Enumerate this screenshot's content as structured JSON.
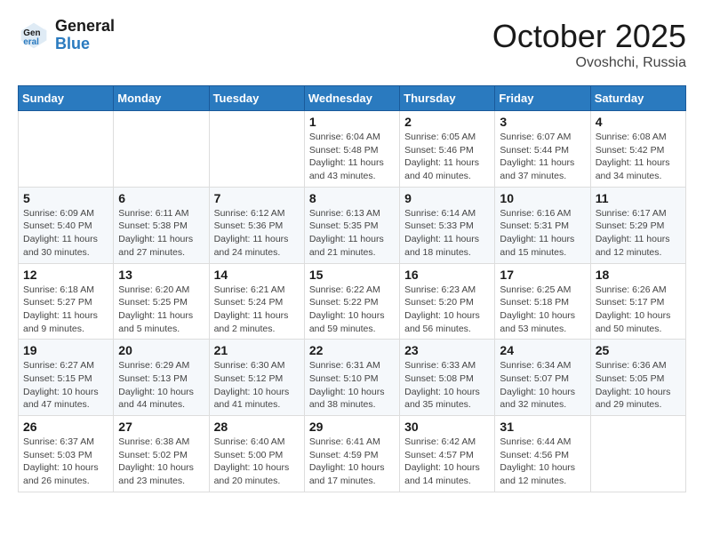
{
  "header": {
    "logo_general": "General",
    "logo_blue": "Blue",
    "month": "October 2025",
    "location": "Ovoshchi, Russia"
  },
  "weekdays": [
    "Sunday",
    "Monday",
    "Tuesday",
    "Wednesday",
    "Thursday",
    "Friday",
    "Saturday"
  ],
  "weeks": [
    [
      {
        "day": "",
        "info": ""
      },
      {
        "day": "",
        "info": ""
      },
      {
        "day": "",
        "info": ""
      },
      {
        "day": "1",
        "info": "Sunrise: 6:04 AM\nSunset: 5:48 PM\nDaylight: 11 hours\nand 43 minutes."
      },
      {
        "day": "2",
        "info": "Sunrise: 6:05 AM\nSunset: 5:46 PM\nDaylight: 11 hours\nand 40 minutes."
      },
      {
        "day": "3",
        "info": "Sunrise: 6:07 AM\nSunset: 5:44 PM\nDaylight: 11 hours\nand 37 minutes."
      },
      {
        "day": "4",
        "info": "Sunrise: 6:08 AM\nSunset: 5:42 PM\nDaylight: 11 hours\nand 34 minutes."
      }
    ],
    [
      {
        "day": "5",
        "info": "Sunrise: 6:09 AM\nSunset: 5:40 PM\nDaylight: 11 hours\nand 30 minutes."
      },
      {
        "day": "6",
        "info": "Sunrise: 6:11 AM\nSunset: 5:38 PM\nDaylight: 11 hours\nand 27 minutes."
      },
      {
        "day": "7",
        "info": "Sunrise: 6:12 AM\nSunset: 5:36 PM\nDaylight: 11 hours\nand 24 minutes."
      },
      {
        "day": "8",
        "info": "Sunrise: 6:13 AM\nSunset: 5:35 PM\nDaylight: 11 hours\nand 21 minutes."
      },
      {
        "day": "9",
        "info": "Sunrise: 6:14 AM\nSunset: 5:33 PM\nDaylight: 11 hours\nand 18 minutes."
      },
      {
        "day": "10",
        "info": "Sunrise: 6:16 AM\nSunset: 5:31 PM\nDaylight: 11 hours\nand 15 minutes."
      },
      {
        "day": "11",
        "info": "Sunrise: 6:17 AM\nSunset: 5:29 PM\nDaylight: 11 hours\nand 12 minutes."
      }
    ],
    [
      {
        "day": "12",
        "info": "Sunrise: 6:18 AM\nSunset: 5:27 PM\nDaylight: 11 hours\nand 9 minutes."
      },
      {
        "day": "13",
        "info": "Sunrise: 6:20 AM\nSunset: 5:25 PM\nDaylight: 11 hours\nand 5 minutes."
      },
      {
        "day": "14",
        "info": "Sunrise: 6:21 AM\nSunset: 5:24 PM\nDaylight: 11 hours\nand 2 minutes."
      },
      {
        "day": "15",
        "info": "Sunrise: 6:22 AM\nSunset: 5:22 PM\nDaylight: 10 hours\nand 59 minutes."
      },
      {
        "day": "16",
        "info": "Sunrise: 6:23 AM\nSunset: 5:20 PM\nDaylight: 10 hours\nand 56 minutes."
      },
      {
        "day": "17",
        "info": "Sunrise: 6:25 AM\nSunset: 5:18 PM\nDaylight: 10 hours\nand 53 minutes."
      },
      {
        "day": "18",
        "info": "Sunrise: 6:26 AM\nSunset: 5:17 PM\nDaylight: 10 hours\nand 50 minutes."
      }
    ],
    [
      {
        "day": "19",
        "info": "Sunrise: 6:27 AM\nSunset: 5:15 PM\nDaylight: 10 hours\nand 47 minutes."
      },
      {
        "day": "20",
        "info": "Sunrise: 6:29 AM\nSunset: 5:13 PM\nDaylight: 10 hours\nand 44 minutes."
      },
      {
        "day": "21",
        "info": "Sunrise: 6:30 AM\nSunset: 5:12 PM\nDaylight: 10 hours\nand 41 minutes."
      },
      {
        "day": "22",
        "info": "Sunrise: 6:31 AM\nSunset: 5:10 PM\nDaylight: 10 hours\nand 38 minutes."
      },
      {
        "day": "23",
        "info": "Sunrise: 6:33 AM\nSunset: 5:08 PM\nDaylight: 10 hours\nand 35 minutes."
      },
      {
        "day": "24",
        "info": "Sunrise: 6:34 AM\nSunset: 5:07 PM\nDaylight: 10 hours\nand 32 minutes."
      },
      {
        "day": "25",
        "info": "Sunrise: 6:36 AM\nSunset: 5:05 PM\nDaylight: 10 hours\nand 29 minutes."
      }
    ],
    [
      {
        "day": "26",
        "info": "Sunrise: 6:37 AM\nSunset: 5:03 PM\nDaylight: 10 hours\nand 26 minutes."
      },
      {
        "day": "27",
        "info": "Sunrise: 6:38 AM\nSunset: 5:02 PM\nDaylight: 10 hours\nand 23 minutes."
      },
      {
        "day": "28",
        "info": "Sunrise: 6:40 AM\nSunset: 5:00 PM\nDaylight: 10 hours\nand 20 minutes."
      },
      {
        "day": "29",
        "info": "Sunrise: 6:41 AM\nSunset: 4:59 PM\nDaylight: 10 hours\nand 17 minutes."
      },
      {
        "day": "30",
        "info": "Sunrise: 6:42 AM\nSunset: 4:57 PM\nDaylight: 10 hours\nand 14 minutes."
      },
      {
        "day": "31",
        "info": "Sunrise: 6:44 AM\nSunset: 4:56 PM\nDaylight: 10 hours\nand 12 minutes."
      },
      {
        "day": "",
        "info": ""
      }
    ]
  ]
}
